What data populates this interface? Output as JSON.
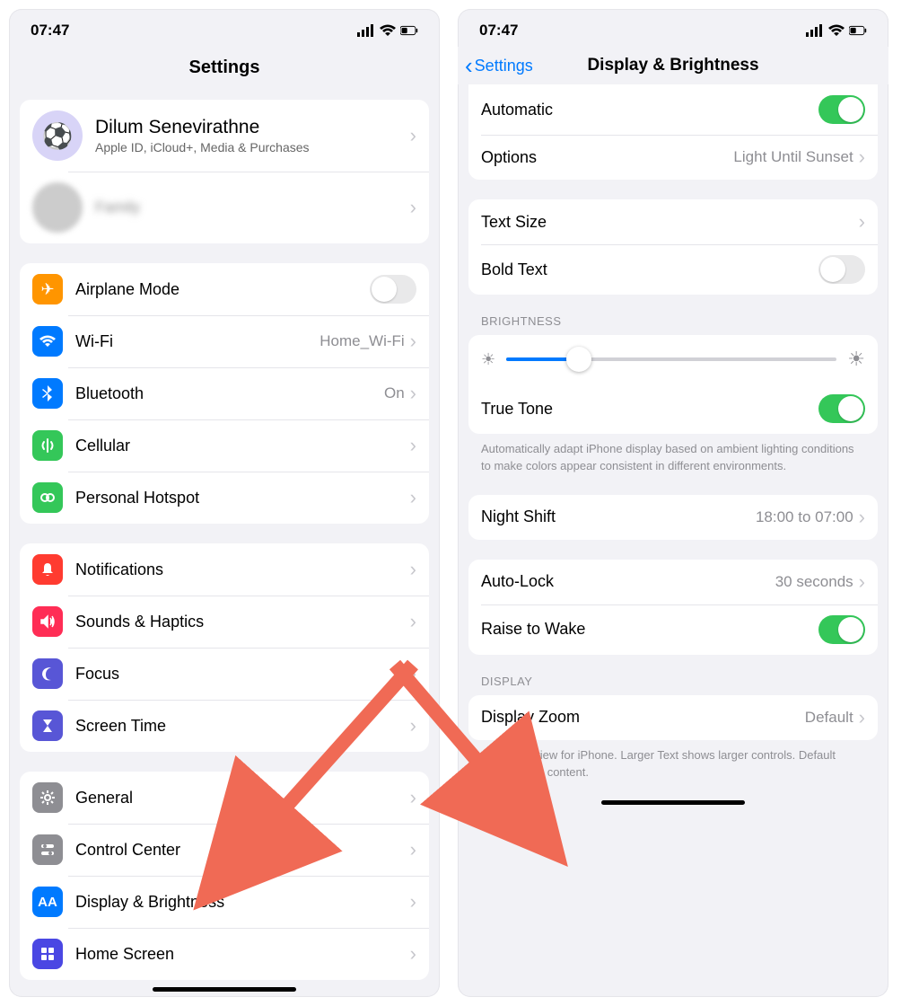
{
  "status": {
    "time": "07:47"
  },
  "left": {
    "title": "Settings",
    "profile": {
      "name": "Dilum Senevirathne",
      "subtitle": "Apple ID, iCloud+, Media & Purchases"
    },
    "g1": {
      "airplane": "Airplane Mode",
      "wifi": "Wi-Fi",
      "wifi_value": "Home_Wi-Fi",
      "bluetooth": "Bluetooth",
      "bluetooth_value": "On",
      "cellular": "Cellular",
      "hotspot": "Personal Hotspot"
    },
    "g2": {
      "notifications": "Notifications",
      "sounds": "Sounds & Haptics",
      "focus": "Focus",
      "screentime": "Screen Time"
    },
    "g3": {
      "general": "General",
      "controlcenter": "Control Center",
      "display": "Display & Brightness",
      "homescreen": "Home Screen"
    }
  },
  "right": {
    "back": "Settings",
    "title": "Display & Brightness",
    "automatic": "Automatic",
    "options": "Options",
    "options_value": "Light Until Sunset",
    "textsize": "Text Size",
    "boldtext": "Bold Text",
    "sec_brightness": "BRIGHTNESS",
    "truetone": "True Tone",
    "truetone_footer": "Automatically adapt iPhone display based on ambient lighting conditions to make colors appear consistent in different environments.",
    "nightshift": "Night Shift",
    "nightshift_value": "18:00 to 07:00",
    "autolock": "Auto-Lock",
    "autolock_value": "30 seconds",
    "raisewake": "Raise to Wake",
    "sec_display": "DISPLAY",
    "displayzoom": "Display Zoom",
    "displayzoom_value": "Default",
    "displayzoom_footer": "Choose a view for iPhone. Larger Text shows larger controls. Default shows more content."
  }
}
